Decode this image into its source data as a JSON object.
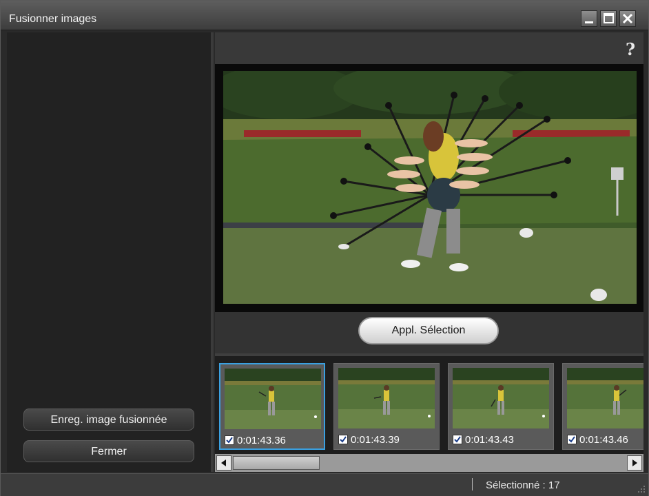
{
  "window": {
    "title": "Fusionner images",
    "controls": [
      "minimize-icon",
      "maximize-icon",
      "close-icon"
    ]
  },
  "left_panel": {
    "save_button": "Enreg. image fusionnée",
    "close_button": "Fermer"
  },
  "toolbar": {
    "help_label": "?"
  },
  "apply": {
    "label": "Appl. Sélection"
  },
  "thumbnails": [
    {
      "time": "0:01:43.36",
      "checked": true,
      "selected": true
    },
    {
      "time": "0:01:43.39",
      "checked": true,
      "selected": false
    },
    {
      "time": "0:01:43.43",
      "checked": true,
      "selected": false
    },
    {
      "time": "0:01:43.46",
      "checked": true,
      "selected": false
    }
  ],
  "status": {
    "selected_text": "Sélectionné : 17"
  },
  "colors": {
    "accent": "#3aa0e0",
    "background": "#2a2a2a"
  }
}
